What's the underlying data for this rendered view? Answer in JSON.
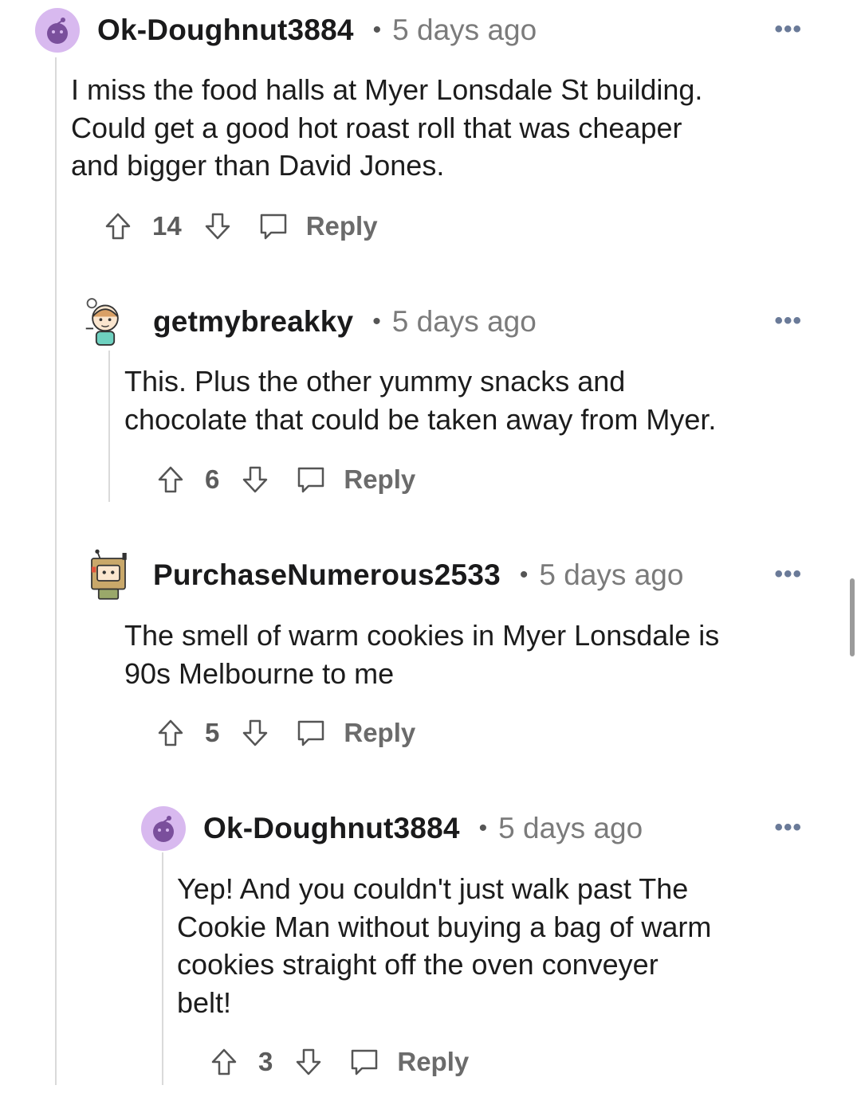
{
  "comments": [
    {
      "username": "Ok-Doughnut3884",
      "separator": "•",
      "time": "5 days ago",
      "more": "•••",
      "body": "I miss the food halls at Myer Lonsdale St building.\nCould get a good hot roast roll that was cheaper\nand bigger than David Jones.",
      "votes": "14",
      "reply_label": "Reply",
      "avatar_icon": "snoo-avatar-icon"
    },
    {
      "username": "getmybreakky",
      "separator": "•",
      "time": "5 days ago",
      "more": "•••",
      "body": "This. Plus the other yummy snacks and\nchocolate that could be taken away from Myer.",
      "votes": "6",
      "reply_label": "Reply",
      "avatar_icon": "custom-avatar-icon"
    },
    {
      "username": "PurchaseNumerous2533",
      "separator": "•",
      "time": "5 days ago",
      "more": "•••",
      "body": "The smell of warm cookies in Myer Lonsdale is\n90s Melbourne to me",
      "votes": "5",
      "reply_label": "Reply",
      "avatar_icon": "robot-avatar-icon"
    },
    {
      "username": "Ok-Doughnut3884",
      "separator": "•",
      "time": "5 days ago",
      "more": "•••",
      "body": "Yep! And you couldn't just walk past The\nCookie Man without buying a bag of warm\ncookies straight off the oven conveyer\nbelt!",
      "votes": "3",
      "reply_label": "Reply",
      "avatar_icon": "snoo-avatar-icon"
    }
  ],
  "colors": {
    "avatar_purple": "#d8b9ef",
    "snoo_body": "#7a4f9c",
    "thread_line": "#dadada",
    "username": "#1a1a1b",
    "meta": "#7b7b7b"
  }
}
